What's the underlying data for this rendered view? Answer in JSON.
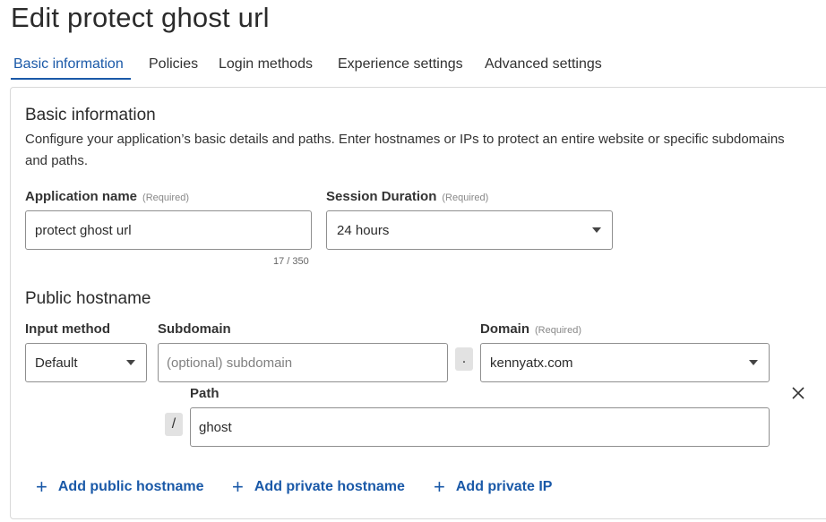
{
  "page": {
    "title": "Edit protect ghost url"
  },
  "tabs": [
    {
      "label": "Basic information"
    },
    {
      "label": "Policies"
    },
    {
      "label": "Login methods"
    },
    {
      "label": "Experience settings"
    },
    {
      "label": "Advanced settings"
    }
  ],
  "basic_info": {
    "heading": "Basic information",
    "description": "Configure your application’s basic details and paths. Enter hostnames or IPs to protect an entire website or specific subdomains and paths.",
    "app_name": {
      "label": "Application name",
      "required": "(Required)",
      "value": "protect ghost url",
      "counter": "17 / 350"
    },
    "session_duration": {
      "label": "Session Duration",
      "required": "(Required)",
      "value": "24 hours"
    }
  },
  "public_hostname": {
    "heading": "Public hostname",
    "input_method": {
      "label": "Input method",
      "value": "Default"
    },
    "subdomain": {
      "label": "Subdomain",
      "placeholder": "(optional) subdomain"
    },
    "dot": ".",
    "domain": {
      "label": "Domain",
      "required": "(Required)",
      "value": "kennyatx.com"
    },
    "path": {
      "label": "Path",
      "slash": "/",
      "value": "ghost"
    }
  },
  "actions": {
    "plus": "+",
    "add_public": "Add public hostname",
    "add_private": "Add private hostname",
    "add_ip": "Add private IP"
  },
  "colors": {
    "accent": "#1a59a8",
    "border": "#8f8f8f",
    "pill_bg": "#e2e2e2"
  },
  "icons": {
    "dropdown": "chevron-down-icon",
    "remove": "close-icon",
    "add": "plus-icon"
  }
}
